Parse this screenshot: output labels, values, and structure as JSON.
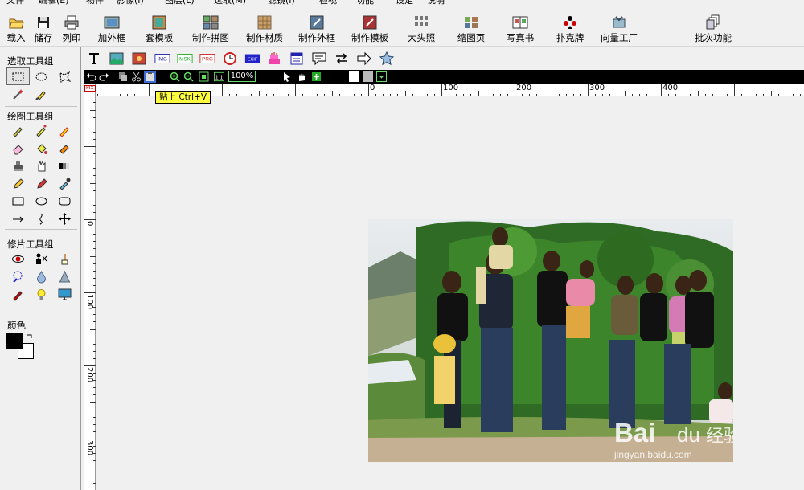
{
  "menu": [
    "文件",
    "编辑(E)",
    "物件",
    "影像(I)",
    "图层(L)",
    "选取(M)",
    "滤镜(I)",
    "检视",
    "功能",
    "设定",
    "说明"
  ],
  "toolbar": [
    {
      "label": "载入",
      "icon": "open-folder-icon"
    },
    {
      "label": "储存",
      "icon": "save-disk-icon"
    },
    {
      "label": "列印",
      "icon": "printer-icon"
    },
    {
      "label": "加外框",
      "icon": "frame-icon"
    },
    {
      "label": "套模板",
      "icon": "template-icon"
    },
    {
      "label": "制作拼图",
      "icon": "collage-icon"
    },
    {
      "label": "制作材质",
      "icon": "texture-icon"
    },
    {
      "label": "制作外框",
      "icon": "make-frame-icon"
    },
    {
      "label": "制作模板",
      "icon": "make-template-icon"
    },
    {
      "label": "大头照",
      "icon": "id-photo-icon"
    },
    {
      "label": "缩图页",
      "icon": "thumbnail-page-icon"
    },
    {
      "label": "写真书",
      "icon": "photo-book-icon"
    },
    {
      "label": "扑克牌",
      "icon": "playing-cards-icon"
    },
    {
      "label": "向量工厂",
      "icon": "vector-factory-icon"
    },
    {
      "label": "批次功能",
      "icon": "batch-icon"
    }
  ],
  "left_panel": {
    "select_group": "选取工具组",
    "draw_group": "绘图工具组",
    "retouch_group": "修片工具组",
    "color_label": "颜色"
  },
  "secondary_toolbar": [
    "text-tool-icon",
    "image-insert-icon",
    "photo-insert-icon",
    "img-badge-icon",
    "msk-badge-icon",
    "prg-badge-icon",
    "clock-icon",
    "exif-badge-icon",
    "cake-icon",
    "calendar-icon",
    "speech-bubble-icon",
    "swap-arrows-icon",
    "arrow-shape-icon",
    "star-shape-icon"
  ],
  "badges": {
    "img": "IMG",
    "msk": "MSK",
    "prg": "PRG",
    "exif": "EXIF"
  },
  "edit_bar": {
    "zoom": "100%",
    "ratio": "1:1"
  },
  "tooltip": "贴上  Ctrl+V",
  "ruler": {
    "h_labels": [
      "0",
      "100",
      "200",
      "300",
      "400"
    ],
    "v_labels": [
      "0",
      "100",
      "200",
      "300"
    ],
    "corner": "PIX"
  },
  "watermark": {
    "brand": "Bai",
    "paw": "du",
    "cn": "经验",
    "url": "jingyan.baidu.com"
  },
  "colors": {
    "foreground": "#000000",
    "background": "#ffffff",
    "accent": "#ffff40"
  }
}
